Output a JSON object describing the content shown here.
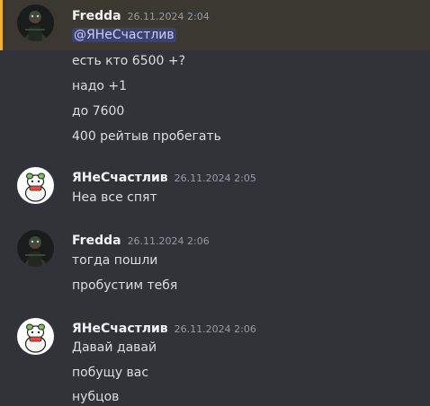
{
  "messages": [
    {
      "author": "Fredda",
      "timestamp": "26.11.2024 2:04",
      "avatar_icon": "dark-character-avatar-icon",
      "mention": "@ЯНеСчастлив",
      "lines": [
        "есть кто 6500 +?",
        "надо +1",
        "до 7600",
        "400 рейтыв пробегать"
      ]
    },
    {
      "author": "ЯНеСчастлив",
      "timestamp": "26.11.2024 2:05",
      "avatar_icon": "cartoon-frog-avatar-icon",
      "lines": [
        "Неа все спят"
      ]
    },
    {
      "author": "Fredda",
      "timestamp": "26.11.2024 2:06",
      "avatar_icon": "dark-character-avatar-icon",
      "lines": [
        "тогда пошли",
        "пробустим тебя"
      ]
    },
    {
      "author": "ЯНеСчастлив",
      "timestamp": "26.11.2024 2:06",
      "avatar_icon": "cartoon-frog-avatar-icon",
      "lines": [
        "Давай давай",
        "побущу вас",
        "нубцов"
      ]
    }
  ],
  "colors": {
    "background": "#313338",
    "mention_highlight": "#3b3831",
    "mention_bar": "#f0b232",
    "mention_pill": "#3c4270",
    "username": "#f2f3f5",
    "text": "#dbdee1",
    "timestamp": "#949ba4"
  }
}
